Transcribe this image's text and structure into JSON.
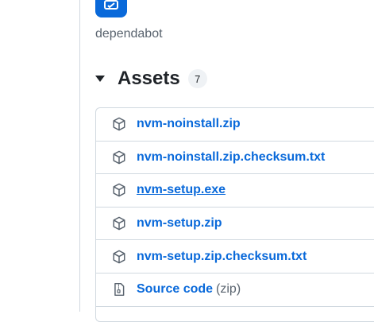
{
  "author": {
    "name": "dependabot"
  },
  "assets": {
    "title": "Assets",
    "count": "7",
    "items": [
      {
        "label": "nvm-noinstall.zip",
        "icon": "package-icon"
      },
      {
        "label": "nvm-noinstall.zip.checksum.txt",
        "icon": "package-icon"
      },
      {
        "label": "nvm-setup.exe",
        "icon": "package-icon",
        "hovered": true
      },
      {
        "label": "nvm-setup.zip",
        "icon": "package-icon"
      },
      {
        "label": "nvm-setup.zip.checksum.txt",
        "icon": "package-icon"
      },
      {
        "label": "Source code",
        "suffix": "(zip)",
        "icon": "file-zip-icon"
      }
    ]
  },
  "colors": {
    "link": "#0969da",
    "muted": "#59636e",
    "border": "#d1d9e0"
  }
}
